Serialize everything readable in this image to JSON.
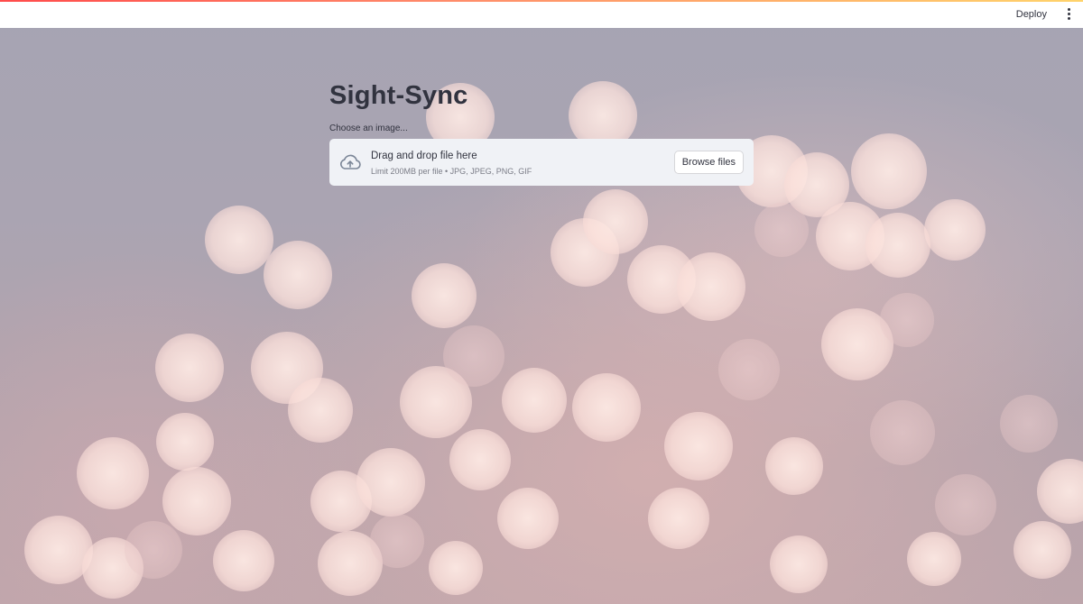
{
  "header": {
    "deploy_label": "Deploy",
    "menu_icon": "more-vertical-icon",
    "accent_gradient": [
      "#ff4b4b",
      "#ffd36b"
    ]
  },
  "main": {
    "title": "Sight-Sync",
    "uploader": {
      "label": "Choose an image...",
      "dropzone_title": "Drag and drop file here",
      "dropzone_limit": "Limit 200MB per file • JPG, JPEG, PNG, GIF",
      "browse_label": "Browse files",
      "upload_icon": "cloud-upload-icon"
    }
  },
  "colors": {
    "text": "#31333f",
    "dropzone_bg": "#f0f2f6",
    "muted_text": "#7b7d87",
    "background_tone": "#b9b3bf"
  }
}
